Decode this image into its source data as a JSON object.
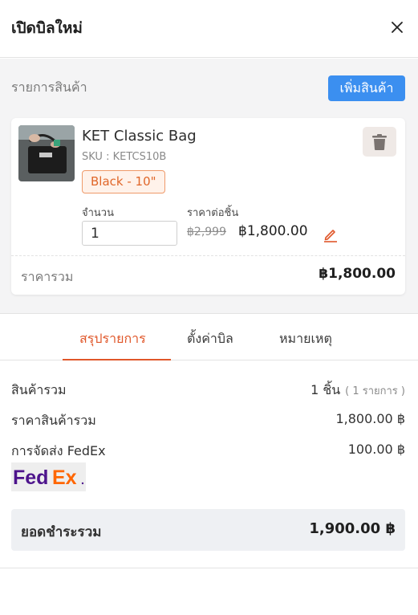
{
  "header": {
    "title": "เปิดบิลใหม่"
  },
  "products_section": {
    "label": "รายการสินค้า",
    "add_button_label": "เพิ่มสินค้า"
  },
  "product": {
    "name": "KET Classic Bag",
    "sku": "SKU : KETCS10B",
    "variant": "Black - 10\"",
    "quantity_label": "จำนวน",
    "quantity_value": "1",
    "unit_price_label": "ราคาต่อชิ้น",
    "original_price": "฿2,999",
    "price": "฿1,800.00",
    "total_label": "ราคารวม",
    "total_value": "฿1,800.00"
  },
  "tabs": [
    {
      "label": "สรุปรายการ",
      "active": true
    },
    {
      "label": "ตั้งค่าบิล",
      "active": false
    },
    {
      "label": "หมายเหตุ",
      "active": false
    }
  ],
  "summary": {
    "items_label": "สินค้ารวม",
    "items_count": "1 ชิ้น",
    "items_sub": "( 1 รายการ )",
    "subtotal_label": "ราคาสินค้ารวม",
    "subtotal_value": "1,800.00 ฿",
    "shipping_label": "การจัดส่ง FedEx",
    "shipping_value": "100.00 ฿",
    "grand_total_label": "ยอดชำระรวม",
    "grand_total_value": "1,900.00 ฿"
  },
  "colors": {
    "accent": "#e0572a",
    "primary_button": "#3b8ff0",
    "fedex_purple": "#4d148c",
    "fedex_orange": "#ff6600"
  },
  "icons": {
    "close": "close-icon",
    "delete": "trash-icon",
    "edit": "pencil-icon"
  }
}
